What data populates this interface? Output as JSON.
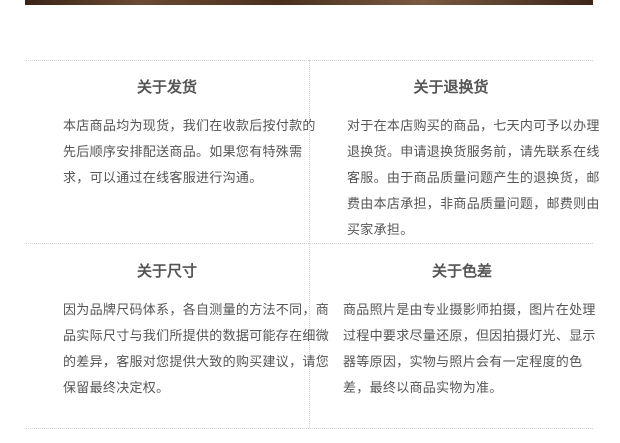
{
  "shipping": {
    "title": "关于发货",
    "body": "本店商品均为现货，我们在收款后按付款的先后顺序安排配送商品。如果您有特殊需求，可以通过在线客服进行沟通。"
  },
  "returns": {
    "title": "关于退换货",
    "body": "对于在本店购买的商品，七天内可予以办理退换货。申请退换货服务前，请先联系在线客服。由于商品质量问题产生的退换货，邮费由本店承担，非商品质量问题，邮费则由买家承担。"
  },
  "size": {
    "title": "关于尺寸",
    "body": "因为品牌尺码体系，各自测量的方法不同，商品实际尺寸与我们所提供的数据可能存在细微的差异，客服对您提供大致的购买建议，请您保留最终决定权。"
  },
  "color": {
    "title": "关于色差",
    "body": "商品照片是由专业摄影师拍摄，图片在处理过程中要求尽量还原，但因拍摄灯光、显示器等原因，实物与照片会有一定程度的色差，最终以商品实物为准。"
  },
  "colors": {
    "text": "#555555",
    "divider": "#d0d0d0"
  }
}
